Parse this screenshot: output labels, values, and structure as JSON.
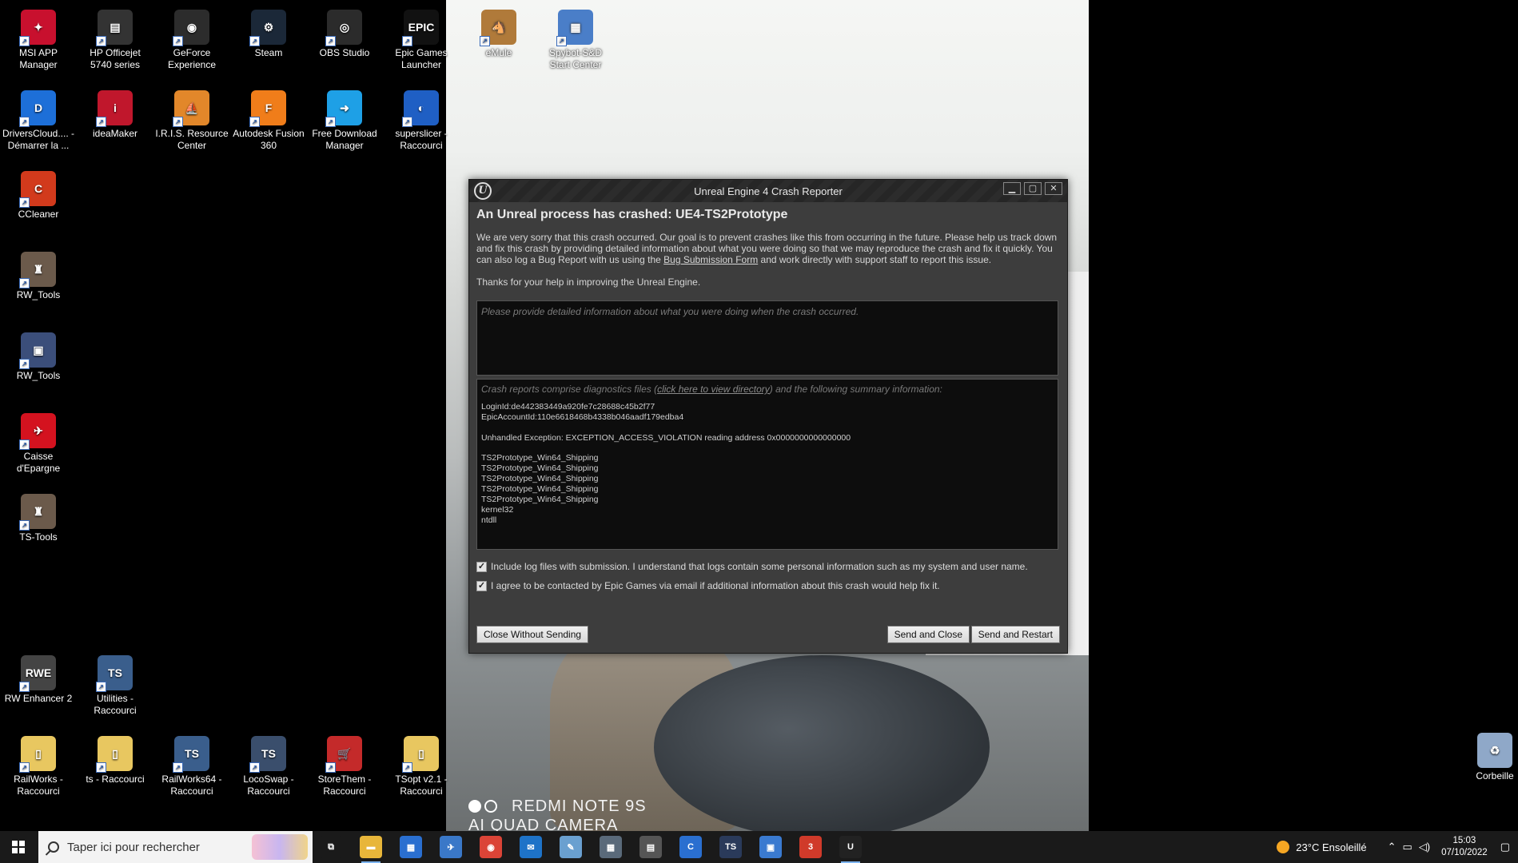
{
  "desktop": {
    "icons": [
      {
        "label": "MSI APP Manager",
        "color": "#c8102e",
        "glyph": "✦"
      },
      {
        "label": "HP Officejet 5740 series",
        "color": "#333333",
        "glyph": "▤"
      },
      {
        "label": "GeForce Experience",
        "color": "#2c2c2c",
        "glyph": "◉"
      },
      {
        "label": "Steam",
        "color": "#1b2838",
        "glyph": "⚙"
      },
      {
        "label": "OBS Studio",
        "color": "#2b2b2b",
        "glyph": "◎"
      },
      {
        "label": "Epic Games Launcher",
        "color": "#111111",
        "glyph": "EPIC"
      },
      {
        "label": "DriversCloud.... - Démarrer la ...",
        "color": "#1d6fd8",
        "glyph": "D"
      },
      {
        "label": "ideaMaker",
        "color": "#c0172c",
        "glyph": "i"
      },
      {
        "label": "I.R.I.S. Resource Center",
        "color": "#e2872a",
        "glyph": "⛵"
      },
      {
        "label": "Autodesk Fusion 360",
        "color": "#f07d1a",
        "glyph": "F"
      },
      {
        "label": "Free Download Manager",
        "color": "#1ea0e6",
        "glyph": "➜"
      },
      {
        "label": "superslicer - Raccourci",
        "color": "#1f5fc4",
        "glyph": "◐"
      },
      {
        "label": "CCleaner",
        "color": "#d23a1c",
        "glyph": "C"
      },
      {
        "label": "RW_Tools",
        "color": "#6b5a4b",
        "glyph": "♜"
      },
      {
        "label": "RW_Tools",
        "color": "#3b4e7a",
        "glyph": "▣"
      },
      {
        "label": "Caisse d'Epargne",
        "color": "#d4121f",
        "glyph": "✈"
      },
      {
        "label": "TS-Tools",
        "color": "#6b5a4b",
        "glyph": "♜"
      },
      {
        "label": "RW Enhancer 2",
        "color": "#444444",
        "glyph": "RWE"
      },
      {
        "label": "Utilities - Raccourci",
        "color": "#3a5e8c",
        "glyph": "TS"
      },
      {
        "label": "RailWorks - Raccourci",
        "color": "#e8c760",
        "glyph": "▯"
      },
      {
        "label": "ts - Raccourci",
        "color": "#e8c760",
        "glyph": "▯"
      },
      {
        "label": "RailWorks64 - Raccourci",
        "color": "#3a5e8c",
        "glyph": "TS"
      },
      {
        "label": "LocoSwap - Raccourci",
        "color": "#3a4e6c",
        "glyph": "TS"
      },
      {
        "label": "StoreThem - Raccourci",
        "color": "#c42a2a",
        "glyph": "🛒"
      },
      {
        "label": "TSopt v2.1 - Raccourci",
        "color": "#e8c760",
        "glyph": "▯"
      },
      {
        "label": "eMule",
        "color": "#b07a3a",
        "glyph": "🐴"
      },
      {
        "label": "Spybot-S&D Start Center",
        "color": "#4a7ec8",
        "glyph": "▦"
      },
      {
        "label": "Corbeille",
        "color": "#8fa8c8",
        "glyph": "♻"
      }
    ]
  },
  "wallpaper": {
    "watermark_line1": "REDMI NOTE 9S",
    "watermark_line2": "AI QUAD CAMERA"
  },
  "crash_window": {
    "title": "Unreal Engine 4 Crash Reporter",
    "logo": "U",
    "minimize": "▁",
    "maximize": "▢",
    "close": "✕",
    "heading": "An Unreal process has crashed: UE4-TS2Prototype",
    "description_pre": "We are very sorry that this crash occurred. Our goal is to prevent crashes like this from occurring in the future. Please help us track down and fix this crash by providing detailed information about what you were doing so that we may reproduce the crash and fix it quickly. You can also log a Bug Report with us using the ",
    "description_link": "Bug Submission Form",
    "description_post": " and work directly with support staff to report this issue.",
    "thanks": "Thanks for your help in improving the Unreal Engine.",
    "input_placeholder": "Please provide detailed information about what you were doing when the crash occurred.",
    "diag_pre": "Crash reports comprise diagnostics files (",
    "diag_link": "click here to view directory",
    "diag_post": ") and the following summary information:",
    "login_id": "LoginId:de442383449a920fe7c28688c45b2f77",
    "account_id": "EpicAccountId:110e6618468b4338b046aadf179edba4",
    "exception": "Unhandled Exception: EXCEPTION_ACCESS_VIOLATION reading address 0x0000000000000000",
    "callstack": [
      "TS2Prototype_Win64_Shipping",
      "TS2Prototype_Win64_Shipping",
      "TS2Prototype_Win64_Shipping",
      "TS2Prototype_Win64_Shipping",
      "TS2Prototype_Win64_Shipping",
      "kernel32",
      "ntdll"
    ],
    "include_logs_label": "Include log files with submission. I understand that logs contain some personal information such as my system and user name.",
    "include_logs_checked": true,
    "agree_contact_label": "I agree to be contacted by Epic Games via email if additional information about this crash would help fix it.",
    "agree_contact_checked": true,
    "close_without_sending": "Close Without Sending",
    "send_and_close": "Send and Close",
    "send_and_restart": "Send and Restart"
  },
  "taskbar": {
    "search_placeholder": "Taper ici pour rechercher",
    "apps": [
      {
        "name": "task-view",
        "glyph": "⧉",
        "color": "#1a1a1a"
      },
      {
        "name": "file-explorer",
        "glyph": "▬",
        "color": "#e8b63a"
      },
      {
        "name": "microsoft-store",
        "glyph": "▦",
        "color": "#2a6fd0"
      },
      {
        "name": "app-blue-bird",
        "glyph": "✈",
        "color": "#3a78c8"
      },
      {
        "name": "chrome",
        "glyph": "◉",
        "color": "#db4437"
      },
      {
        "name": "mail",
        "glyph": "✉",
        "color": "#1e73c8"
      },
      {
        "name": "app-notes",
        "glyph": "✎",
        "color": "#6aa0d0"
      },
      {
        "name": "calculator",
        "glyph": "▦",
        "color": "#5a6a7a"
      },
      {
        "name": "app-printer",
        "glyph": "▤",
        "color": "#555555"
      },
      {
        "name": "app-c",
        "glyph": "C",
        "color": "#2a6fd0"
      },
      {
        "name": "app-ts",
        "glyph": "TS",
        "color": "#2a3a5a"
      },
      {
        "name": "photos",
        "glyph": "▣",
        "color": "#3a7ad0"
      },
      {
        "name": "app-3",
        "glyph": "3",
        "color": "#d03a2a"
      },
      {
        "name": "unreal",
        "glyph": "U",
        "color": "#222222"
      }
    ],
    "weather": "23°C  Ensoleillé",
    "time": "15:03",
    "date": "07/10/2022"
  }
}
